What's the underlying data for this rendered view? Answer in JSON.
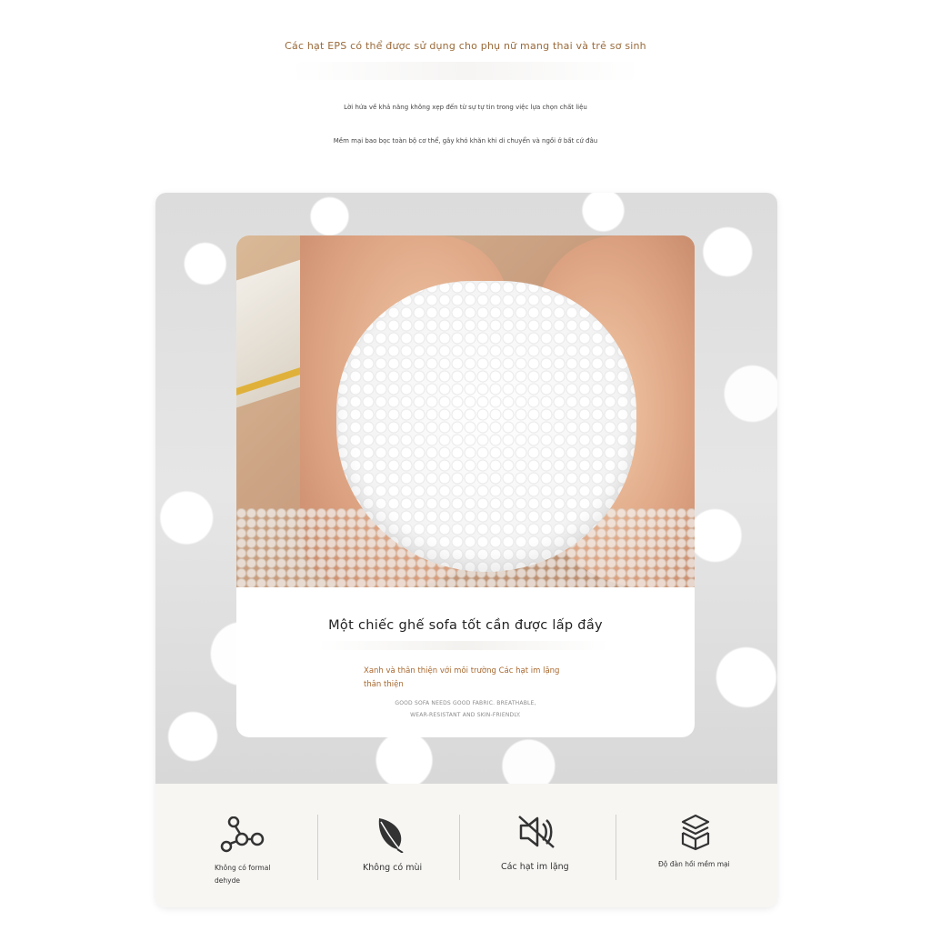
{
  "header": {
    "headline": "Các hạt EPS có thể được sử dụng cho phụ nữ mang thai và trẻ sơ sinh",
    "line1": "Lời hứa về khả năng không xẹp đến từ sự tự tin trong việc lựa chọn chất liệu",
    "line2": "Mềm mại bao bọc toàn bộ cơ thể, gây khó khăn khi di chuyển và ngồi ở bất cứ đâu"
  },
  "card": {
    "title": "Một chiếc ghế sofa tốt cần được lấp đầy",
    "description": "Xanh và thân thiện với môi trường Các hạt im lặng thân thiện",
    "english_line1": "GOOD SOFA NEEDS GOOD FABRIC. BREATHABLE,",
    "english_line2": "WEAR-RESISTANT AND SKIN-FRIENDLY."
  },
  "features": [
    {
      "icon": "molecule-icon",
      "label_line1": "Không có formal",
      "label_line2": "dehyde"
    },
    {
      "icon": "leaf-icon",
      "label": "Không có mùi"
    },
    {
      "icon": "mute-speaker-icon",
      "label": "Các hạt im lặng"
    },
    {
      "icon": "stacked-boxes-icon",
      "label": "Độ đàn hồi mềm mại"
    }
  ],
  "colors": {
    "accent": "#9a6a3a",
    "description": "#a8682f",
    "text": "#333333",
    "panel": "#f7f6f3"
  }
}
